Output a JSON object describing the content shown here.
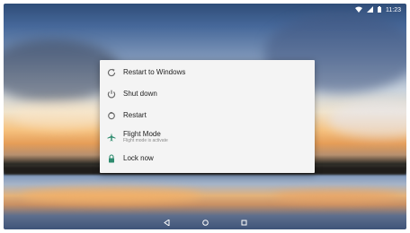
{
  "status": {
    "wifi_icon": "wifi-icon",
    "signal_icon": "signal-icon",
    "battery_icon": "battery-icon",
    "time": "11:23"
  },
  "power_menu": {
    "items": [
      {
        "label": "Restart to Windows",
        "icon": "restart-windows-icon"
      },
      {
        "label": "Shut down",
        "icon": "power-icon"
      },
      {
        "label": "Restart",
        "icon": "restart-icon"
      },
      {
        "label": "Flight Mode",
        "subtitle": "Flight mode is activate",
        "icon": "airplane-icon"
      },
      {
        "label": "Lock now",
        "icon": "lock-icon"
      }
    ]
  },
  "nav": {
    "back_icon": "back-icon",
    "home_icon": "home-icon",
    "recents_icon": "recents-icon"
  },
  "colors": {
    "menu_bg": "#f4f4f4",
    "accent": "#2e8b6e"
  }
}
